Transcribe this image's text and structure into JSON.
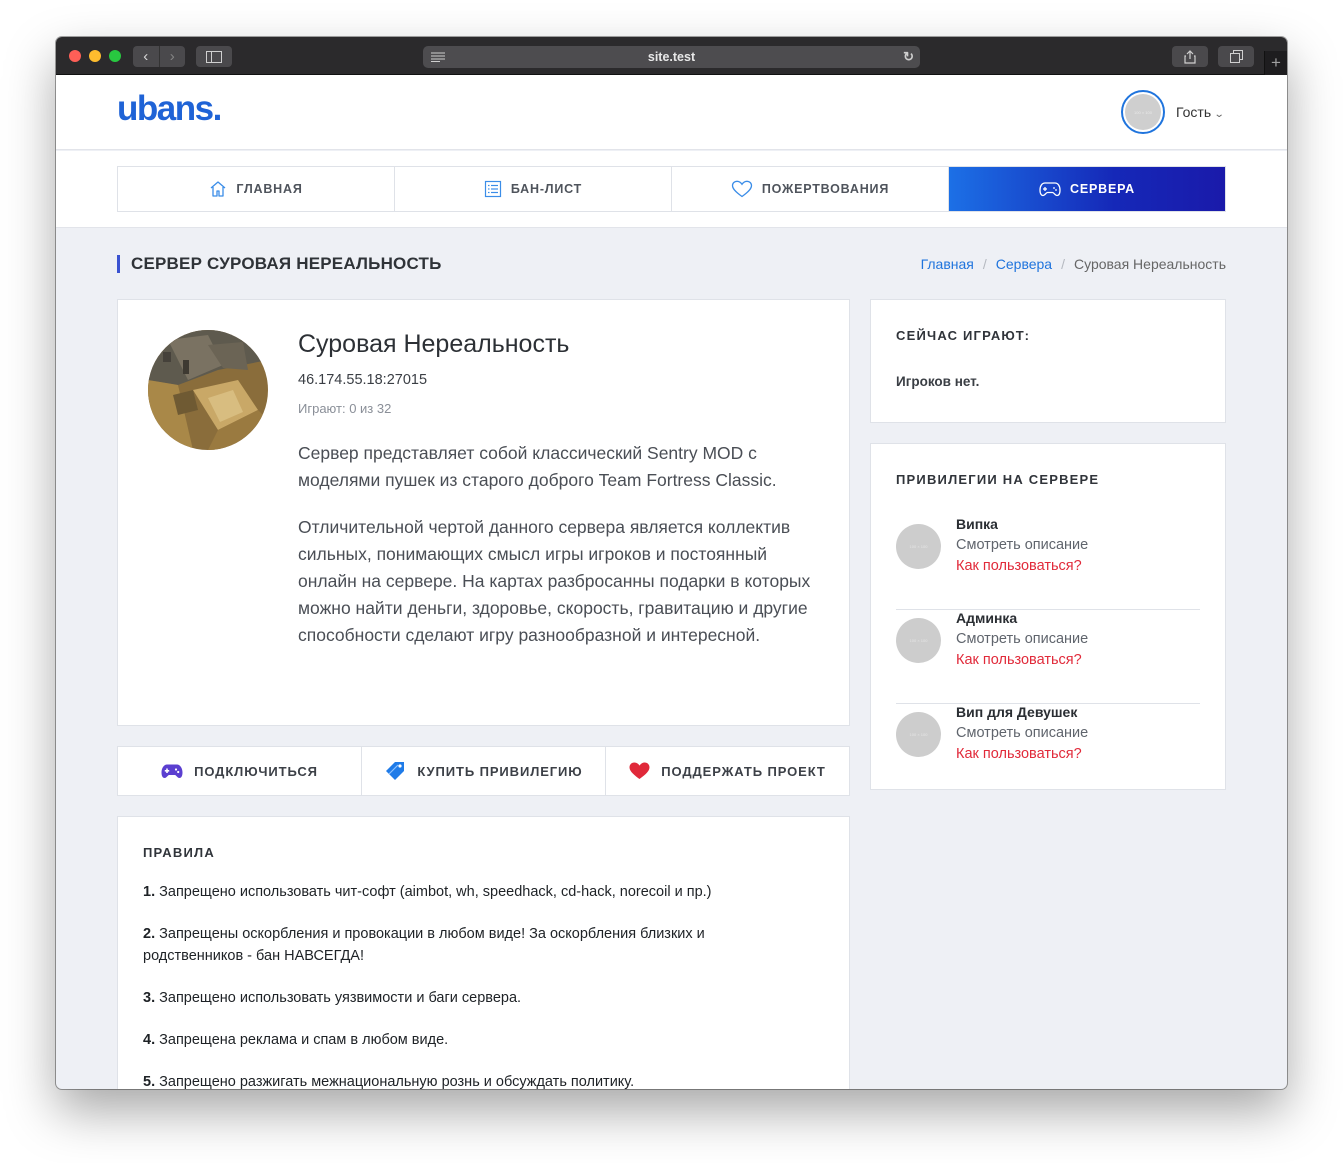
{
  "browser": {
    "url": "site.test"
  },
  "header": {
    "logo": "ubans.",
    "user_label": "Гость",
    "avatar_placeholder": "100 × 100"
  },
  "nav": {
    "tabs": [
      {
        "label": "ГЛАВНАЯ",
        "icon": "home-icon",
        "active": false
      },
      {
        "label": "БАН-ЛИСТ",
        "icon": "list-icon",
        "active": false
      },
      {
        "label": "ПОЖЕРТВОВАНИЯ",
        "icon": "heart-icon",
        "active": false
      },
      {
        "label": "СЕРВЕРА",
        "icon": "gamepad-icon",
        "active": true
      }
    ]
  },
  "page": {
    "title": "СЕРВЕР СУРОВАЯ НЕРЕАЛЬНОСТЬ",
    "breadcrumbs": [
      "Главная",
      "Сервера",
      "Суровая Нереальность"
    ]
  },
  "server": {
    "name": "Суровая Нереальность",
    "ip": "46.174.55.18:27015",
    "players": "Играют: 0 из 32",
    "description": [
      "Сервер представляет собой классический Sentry MOD с моделями пушек из старого доброго Team Fortress Classic.",
      "Отличительной чертой данного сервера является коллектив сильных, понимающих смысл игры игроков и постоянный онлайн на сервере. На картах разбросанны подарки в которых можно найти деньги, здоровье, скорость, гравитацию и другие способности сделают игру разнообразной и интересной."
    ]
  },
  "actions": [
    {
      "label": "ПОДКЛЮЧИТЬСЯ",
      "icon": "gamepad-icon",
      "color": "#5b3fd0"
    },
    {
      "label": "КУПИТЬ ПРИВИЛЕГИЮ",
      "icon": "tag-icon",
      "color": "#1f7be8"
    },
    {
      "label": "ПОДДЕРЖАТЬ ПРОЕКТ",
      "icon": "heart-icon",
      "color": "#e0293a"
    }
  ],
  "rules": {
    "heading": "ПРАВИЛА",
    "items": [
      {
        "num": "1.",
        "text": "Запрещено использовать чит-софт (aimbot, wh, speedhack, cd-hack, norecoil и пр.)"
      },
      {
        "num": "2.",
        "text": "Запрещены оскорбления и провокации в любом виде! За оскорбления близких и родственников - бан НАВСЕГДА!"
      },
      {
        "num": "3.",
        "text": "Запрещено использовать уязвимости и баги сервера."
      },
      {
        "num": "4.",
        "text": "Запрещена реклама и спам в любом виде."
      },
      {
        "num": "5.",
        "text": "Запрещено разжигать межнациональную рознь и обсуждать политику."
      }
    ]
  },
  "playing": {
    "heading": "СЕЙЧАС ИГРАЮТ:",
    "empty": "Игроков нет."
  },
  "privileges": {
    "heading": "ПРИВИЛЕГИИ НА СЕРВЕРЕ",
    "items": [
      {
        "name": "Випка",
        "desc": "Смотреть описание",
        "how": "Как пользоваться?"
      },
      {
        "name": "Админка",
        "desc": "Смотреть описание",
        "how": "Как пользоваться?"
      },
      {
        "name": "Вип для Девушек",
        "desc": "Смотреть описание",
        "how": "Как пользоваться?"
      }
    ]
  },
  "colors": {
    "accent": "#1f74dd",
    "active_tab_gradient": [
      "#1c70e6",
      "#1a1aaa"
    ],
    "danger": "#e12a3a"
  }
}
